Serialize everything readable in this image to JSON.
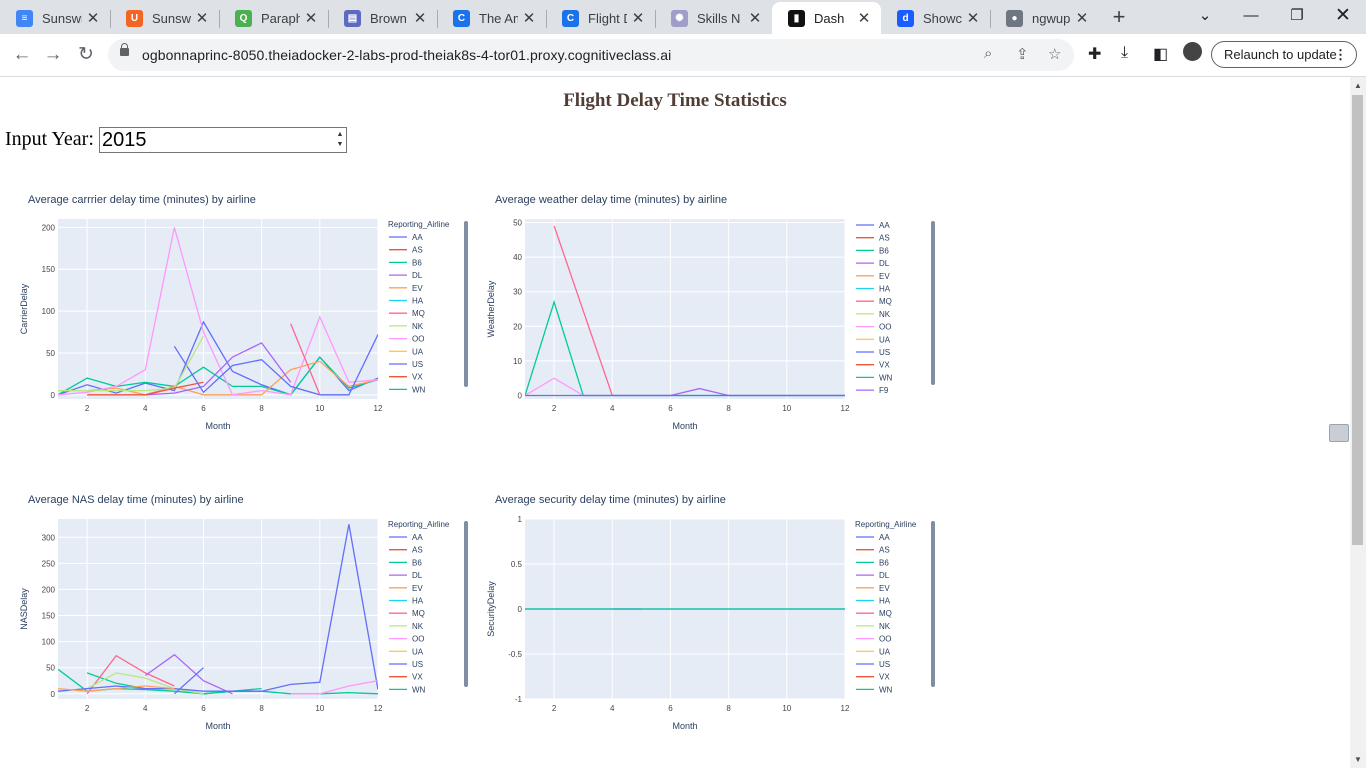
{
  "browser": {
    "tabs": [
      {
        "title": "Sunswit",
        "icon": "docs-icon",
        "color": "#4285f4",
        "glyph": "≡",
        "active": false
      },
      {
        "title": "Sunswit",
        "icon": "unsplash-icon",
        "color": "#f26522",
        "glyph": "U",
        "active": false
      },
      {
        "title": "Paraphr",
        "icon": "quillbot-icon",
        "color": "#4caf50",
        "glyph": "Q",
        "active": false
      },
      {
        "title": "Brown a",
        "icon": "printer-icon",
        "color": "#5c6bc0",
        "glyph": "▤",
        "active": false
      },
      {
        "title": "The Am",
        "icon": "c-logo-icon",
        "color": "#1a73e8",
        "glyph": "C",
        "active": false
      },
      {
        "title": "Flight D",
        "icon": "c-logo-icon",
        "color": "#1a73e8",
        "glyph": "C",
        "active": false
      },
      {
        "title": "Skills N",
        "icon": "skills-icon",
        "color": "#9e9ec8",
        "glyph": "✺",
        "active": false
      },
      {
        "title": "Dash",
        "icon": "dash-icon",
        "color": "#111111",
        "glyph": "▮",
        "active": true
      },
      {
        "title": "Showca",
        "icon": "showcase-icon",
        "color": "#1a5cff",
        "glyph": "d",
        "active": false
      },
      {
        "title": "ngwup",
        "icon": "github-icon",
        "color": "#6e7681",
        "glyph": "●",
        "active": false
      }
    ],
    "url": "ogbonnaprinc-8050.theiadocker-2-labs-prod-theiak8s-4-tor01.proxy.cognitiveclass.ai",
    "relaunch_label": "Relaunch to update"
  },
  "page": {
    "title": "Flight Delay Time Statistics",
    "input_label": "Input Year:",
    "input_value": "2015"
  },
  "airline_colors": {
    "AA": "#636efa",
    "AS": "#ef553b",
    "B6": "#00cc96",
    "DL": "#ab63fa",
    "EV": "#ffa15a",
    "HA": "#19d3f3",
    "MQ": "#ff6692",
    "NK": "#b6e880",
    "OO": "#ff97ff",
    "UA": "#fecb52",
    "US": "#636efa",
    "VX": "#ef553b",
    "WN": "#00cc96",
    "F9": "#ab63fa"
  },
  "chart_data": [
    {
      "type": "line",
      "title": "Average carrrier delay time (minutes) by airline",
      "xlabel": "Month",
      "ylabel": "CarrierDelay",
      "legend_title": "Reporting_Airline",
      "legend": [
        "AA",
        "AS",
        "B6",
        "DL",
        "EV",
        "HA",
        "MQ",
        "NK",
        "OO",
        "UA",
        "US",
        "VX",
        "WN"
      ],
      "x_ticks": [
        2,
        4,
        6,
        8,
        10,
        12
      ],
      "y_ticks": [
        0,
        50,
        100,
        150,
        200
      ],
      "xlim": [
        1,
        12
      ],
      "ylim": [
        -5,
        210
      ],
      "series": [
        {
          "name": "AA",
          "x": [
            1,
            2,
            3,
            4,
            5,
            6,
            7,
            8,
            9,
            10,
            11,
            12
          ],
          "y": [
            0,
            12,
            2,
            14,
            5,
            87,
            28,
            12,
            0,
            45,
            5,
            20
          ]
        },
        {
          "name": "B6",
          "x": [
            1,
            2,
            3,
            4,
            5,
            6,
            7,
            8,
            9,
            10,
            11,
            12
          ],
          "y": [
            0,
            20,
            10,
            15,
            10,
            33,
            10,
            10,
            0,
            45,
            8,
            18
          ]
        },
        {
          "name": "EV",
          "x": [
            1,
            2,
            3,
            4,
            5,
            6,
            7,
            8,
            9,
            10,
            11,
            12
          ],
          "y": [
            5,
            5,
            8,
            0,
            10,
            0,
            0,
            0,
            30,
            40,
            10,
            18
          ]
        },
        {
          "name": "OO",
          "x": [
            1,
            2,
            3,
            4,
            5,
            6,
            7,
            8,
            9,
            10,
            11,
            12
          ],
          "y": [
            0,
            3,
            10,
            30,
            200,
            75,
            0,
            5,
            0,
            93,
            15,
            18
          ]
        },
        {
          "name": "DL",
          "x": [
            4,
            5,
            6,
            7,
            8,
            9
          ],
          "y": [
            0,
            2,
            10,
            45,
            62,
            15
          ]
        },
        {
          "name": "US",
          "x": [
            5,
            6,
            7,
            8,
            9,
            10,
            11,
            12
          ],
          "y": [
            58,
            3,
            35,
            42,
            10,
            0,
            0,
            72
          ]
        },
        {
          "name": "MQ",
          "x": [
            9,
            10
          ],
          "y": [
            85,
            0
          ]
        },
        {
          "name": "NK",
          "x": [
            1,
            2,
            3,
            4,
            5,
            6
          ],
          "y": [
            5,
            5,
            5,
            5,
            8,
            70
          ]
        },
        {
          "name": "VX",
          "x": [
            2,
            3,
            4,
            5,
            6
          ],
          "y": [
            0,
            0,
            0,
            8,
            15
          ]
        }
      ]
    },
    {
      "type": "line",
      "title": "Average weather delay time (minutes) by airline",
      "xlabel": "Month",
      "ylabel": "WeatherDelay",
      "legend_title": "",
      "legend": [
        "AA",
        "AS",
        "B6",
        "DL",
        "EV",
        "HA",
        "MQ",
        "NK",
        "OO",
        "UA",
        "US",
        "VX",
        "WN",
        "F9"
      ],
      "x_ticks": [
        2,
        4,
        6,
        8,
        10,
        12
      ],
      "y_ticks": [
        0,
        10,
        20,
        30,
        40,
        50
      ],
      "xlim": [
        1,
        12
      ],
      "ylim": [
        -1,
        51
      ],
      "series": [
        {
          "name": "MQ",
          "x": [
            2,
            4
          ],
          "y": [
            49,
            0
          ]
        },
        {
          "name": "B6",
          "x": [
            1,
            2,
            3,
            4,
            5,
            6,
            7,
            8,
            9,
            10,
            11,
            12
          ],
          "y": [
            0,
            27,
            0,
            0,
            0,
            0,
            0,
            0,
            0,
            0,
            0,
            0
          ]
        },
        {
          "name": "OO",
          "x": [
            1,
            2,
            3,
            4
          ],
          "y": [
            0,
            5,
            0,
            0
          ]
        },
        {
          "name": "DL",
          "x": [
            4,
            5,
            6,
            7,
            8,
            9,
            10,
            11,
            12
          ],
          "y": [
            0,
            0,
            0,
            2,
            0,
            0,
            0,
            0,
            0
          ]
        },
        {
          "name": "AA",
          "x": [
            1,
            2,
            3,
            4,
            5,
            6,
            7,
            8,
            9,
            10,
            11,
            12
          ],
          "y": [
            0,
            0,
            0,
            0,
            0,
            0,
            0,
            0,
            0,
            0,
            0,
            0
          ]
        }
      ]
    },
    {
      "type": "line",
      "title": "Average NAS delay time (minutes) by airline",
      "xlabel": "Month",
      "ylabel": "NASDelay",
      "legend_title": "Reporting_Airline",
      "legend": [
        "AA",
        "AS",
        "B6",
        "DL",
        "EV",
        "HA",
        "MQ",
        "NK",
        "OO",
        "UA",
        "US",
        "VX",
        "WN"
      ],
      "x_ticks": [
        2,
        4,
        6,
        8,
        10,
        12
      ],
      "y_ticks": [
        0,
        50,
        100,
        150,
        200,
        250,
        300
      ],
      "xlim": [
        1,
        12
      ],
      "ylim": [
        -10,
        335
      ],
      "series": [
        {
          "name": "WN",
          "x": [
            1,
            2,
            3,
            4,
            5,
            6,
            7,
            8,
            9,
            10,
            11,
            12
          ],
          "y": [
            47,
            5,
            10,
            8,
            5,
            0,
            5,
            5,
            0,
            0,
            2,
            0
          ]
        },
        {
          "name": "B6",
          "x": [
            2,
            3,
            4,
            5,
            6,
            7,
            8
          ],
          "y": [
            40,
            20,
            10,
            10,
            0,
            5,
            10
          ]
        },
        {
          "name": "MQ",
          "x": [
            2,
            3,
            4,
            5
          ],
          "y": [
            0,
            73,
            40,
            15
          ]
        },
        {
          "name": "NK",
          "x": [
            1,
            2,
            3,
            4,
            5,
            6
          ],
          "y": [
            5,
            10,
            40,
            30,
            10,
            0
          ]
        },
        {
          "name": "DL",
          "x": [
            4,
            5,
            6,
            7
          ],
          "y": [
            35,
            75,
            25,
            0
          ]
        },
        {
          "name": "US",
          "x": [
            5,
            6
          ],
          "y": [
            0,
            50
          ]
        },
        {
          "name": "AA",
          "x": [
            1,
            2,
            3,
            4,
            5,
            6,
            7,
            8,
            9,
            10,
            11,
            12
          ],
          "y": [
            5,
            10,
            15,
            10,
            10,
            5,
            5,
            5,
            18,
            22,
            325,
            8
          ]
        },
        {
          "name": "OO",
          "x": [
            9,
            10,
            11,
            12
          ],
          "y": [
            0,
            0,
            15,
            25
          ]
        },
        {
          "name": "EV",
          "x": [
            1,
            2,
            3,
            4,
            5
          ],
          "y": [
            10,
            5,
            10,
            15,
            10
          ]
        }
      ]
    },
    {
      "type": "line",
      "title": "Average security delay time (minutes) by airline",
      "xlabel": "Month",
      "ylabel": "SecurityDelay",
      "legend_title": "Reporting_Airline",
      "legend": [
        "AA",
        "AS",
        "B6",
        "DL",
        "EV",
        "HA",
        "MQ",
        "NK",
        "OO",
        "UA",
        "US",
        "VX",
        "WN"
      ],
      "x_ticks": [
        2,
        4,
        6,
        8,
        10,
        12
      ],
      "y_ticks": [
        -1,
        -0.5,
        0,
        0.5,
        1
      ],
      "xlim": [
        1,
        12
      ],
      "ylim": [
        -1,
        1
      ],
      "series": [
        {
          "name": "AA",
          "x": [
            1,
            2,
            3,
            4,
            5,
            6,
            7,
            8,
            9,
            10,
            11,
            12
          ],
          "y": [
            0,
            0,
            0,
            0,
            0,
            0,
            0,
            0,
            0,
            0,
            0,
            0
          ]
        },
        {
          "name": "DL",
          "x": [
            4,
            5
          ],
          "y": [
            0,
            0
          ]
        },
        {
          "name": "B6",
          "x": [
            1,
            2,
            3,
            4,
            5,
            6,
            7,
            8,
            9,
            10,
            11,
            12
          ],
          "y": [
            0,
            0,
            0,
            0,
            0,
            0,
            0,
            0,
            0,
            0,
            0,
            0
          ]
        }
      ]
    }
  ]
}
